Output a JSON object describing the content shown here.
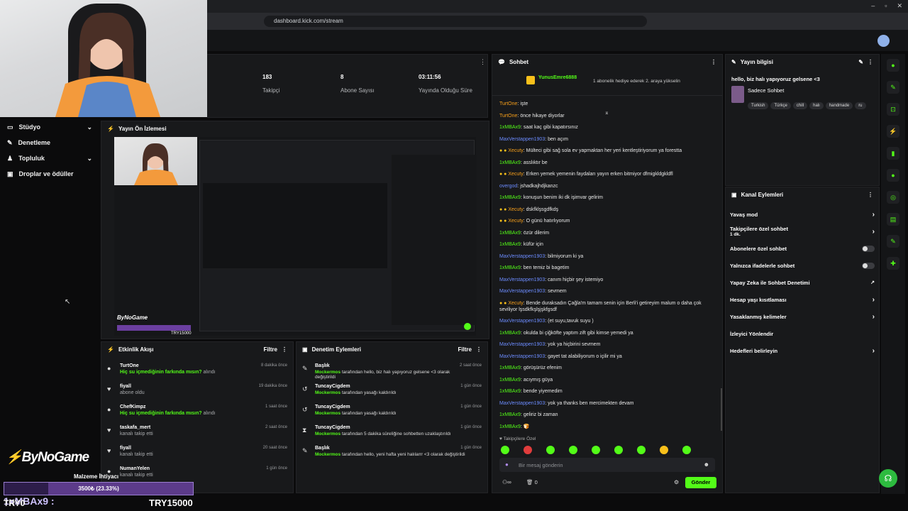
{
  "browser": {
    "url": "dashboard.kick.com/stream"
  },
  "sidebar": {
    "items": [
      {
        "label": "Stüdyo",
        "icon": "studio-icon"
      },
      {
        "label": "Denetleme",
        "icon": "wrench-icon"
      },
      {
        "label": "Topluluk",
        "icon": "community-icon"
      },
      {
        "label": "Droplar ve ödüller",
        "icon": "gift-icon"
      }
    ]
  },
  "stats": [
    {
      "value": "183",
      "label": "Takipçi"
    },
    {
      "value": "8",
      "label": "Abone Sayısı"
    },
    {
      "value": "03:11:56",
      "label": "Yayında Olduğu Süre"
    }
  ],
  "preview": {
    "title": "Yayın Ön İzlemesi",
    "brand": "ByNoGame",
    "goal": "TRY15000"
  },
  "activity": {
    "title": "Etkinlik Akışı",
    "filter": "Filtre",
    "items": [
      {
        "user": "TurtOne",
        "action": "Hiç su içmediğinin farkında mısın?",
        "suffix": "alındı",
        "time": "8 dakika önce"
      },
      {
        "user": "fiyall",
        "action": "abone oldu",
        "suffix": "",
        "time": "19 dakika önce"
      },
      {
        "user": "ChefKimpz",
        "action": "Hiç su içmediğinin farkında mısın?",
        "suffix": "alındı",
        "time": "1 saat önce"
      },
      {
        "user": "taskafa_mert",
        "action": "kanalı takip etti",
        "suffix": "",
        "time": "2 saat önce"
      },
      {
        "user": "fiyall",
        "action": "kanalı takip etti",
        "suffix": "",
        "time": "20 saat önce"
      },
      {
        "user": "NumanYelen",
        "action": "kanalı takip etti",
        "suffix": "",
        "time": "1 gün önce"
      }
    ]
  },
  "moderation": {
    "title": "Denetim Eylemleri",
    "filter": "Filtre",
    "items": [
      {
        "user": "Başlık",
        "mod": "Mockermos",
        "text": "tarafından hello, biz halı yapıyoruz gelsene <3 olarak değiştirildi",
        "time": "2 saat önce"
      },
      {
        "user": "TuncayCigdem",
        "mod": "Mockermos",
        "text": "tarafından yasağı kaldırıldı",
        "time": "1 gün önce"
      },
      {
        "user": "TuncayCigdem",
        "mod": "Mockermos",
        "text": "tarafından yasağı kaldırıldı",
        "time": "1 gün önce"
      },
      {
        "user": "TuncayCigdem",
        "mod": "Mockermos",
        "text": "tarafından 5 dakika süreliğine sohbetten uzaklaştırıldı",
        "time": "1 gün önce"
      },
      {
        "user": "Başlık",
        "mod": "Mockermos",
        "text": "tarafından hello, yeni hafta yeni halılarrr <3 olarak değiştirildi",
        "time": "1 gün önce"
      }
    ]
  },
  "chat": {
    "title": "Sohbet",
    "pinned_user": "YunusEmre6888",
    "pinned_text": "1 abonelik hediye ederek 2. araya yükselin",
    "messages": [
      {
        "user": "TurtOne",
        "color": "orange",
        "text": "işte"
      },
      {
        "user": "TurtOne",
        "color": "orange",
        "text": "önce hikaye diyorlar"
      },
      {
        "user": "1xMBAx9",
        "color": "green",
        "text": "saat kaç gibi kapatırsınız"
      },
      {
        "user": "MaxVerstappen1903",
        "color": "blue",
        "text": "ben açım"
      },
      {
        "user": "Xecuty",
        "color": "orange",
        "text": "Mülteci gibi sağ sola ev yapmaktan her yeri kentleştiriyorum ya forestta"
      },
      {
        "user": "1xMBAx9",
        "color": "green",
        "text": "asslıktır be"
      },
      {
        "user": "Xecuty",
        "color": "orange",
        "text": "Erken yemek yemenin faydaları yayın erken bitmiyor dfmigkldgkldfl"
      },
      {
        "user": "overgod",
        "color": "blue",
        "text": "jshadkajhdjkanzc"
      },
      {
        "user": "1xMBAx9",
        "color": "green",
        "text": "konuşun benim iki dk işimvar gelirim"
      },
      {
        "user": "Xecuty",
        "color": "orange",
        "text": "dskfklşsgdfkdş"
      },
      {
        "user": "Xecuty",
        "color": "orange",
        "text": "O günü hatırlıyorum"
      },
      {
        "user": "1xMBAx9",
        "color": "green",
        "text": "özür dilerim"
      },
      {
        "user": "1xMBAx9",
        "color": "green",
        "text": "küfür için"
      },
      {
        "user": "MaxVerstappen1903",
        "color": "blue",
        "text": "bilmiyorum ki ya"
      },
      {
        "user": "1xMBAx9",
        "color": "green",
        "text": "ben temiz bi bagetim"
      },
      {
        "user": "MaxVerstappen1903",
        "color": "blue",
        "text": "canım hiçbir şey istemiyo"
      },
      {
        "user": "MaxVerstappen1903",
        "color": "blue",
        "text": "sevmem"
      },
      {
        "user": "Xecuty",
        "color": "orange",
        "text": "Bende duraksadın Çağla'm tamam senin için Berli'i getireyim malum o daha çok seviliyor lşsdkfkşlşjşkfgsdf"
      },
      {
        "user": "MaxVerstappen1903",
        "color": "blue",
        "text": "(et suyu,tavuk suyu )"
      },
      {
        "user": "1xMBAx9",
        "color": "green",
        "text": "okulda bi çiğköfte yaptım zift gibi kimse yemedi ya"
      },
      {
        "user": "MaxVerstappen1903",
        "color": "blue",
        "text": "yok ya hiçbirini sevmem"
      },
      {
        "user": "MaxVerstappen1903",
        "color": "blue",
        "text": "gayet tat alabiliyorum o içilir mi ya"
      },
      {
        "user": "1xMBAx9",
        "color": "green",
        "text": "görüşürüz efenim"
      },
      {
        "user": "1xMBAx9",
        "color": "green",
        "text": "acıymış güya"
      },
      {
        "user": "1xMBAx9",
        "color": "green",
        "text": "bende yiyemedim"
      },
      {
        "user": "MaxVerstappen1903",
        "color": "blue",
        "text": "yok ya thanks ben mercimekten devam"
      },
      {
        "user": "1xMBAx9",
        "color": "green",
        "text": "geliriz bi zaman"
      },
      {
        "user": "1xMBAx9",
        "color": "green",
        "text": "🍞"
      }
    ],
    "mode": "Takipçilere Özel",
    "placeholder": "Bir mesaj gönderin",
    "count": "0",
    "send": "Gönder"
  },
  "stream_info": {
    "title": "Yayın bilgisi",
    "stream_title": "hello, biz halı yapıyoruz gelsene <3",
    "category": "Sadece Sohbet",
    "tags": [
      "Turkish",
      "Türkçe",
      "chill",
      "halı",
      "handmade",
      "ru"
    ]
  },
  "channel_actions": {
    "title": "Kanal Eylemleri",
    "items": [
      {
        "label": "Yavaş mod",
        "sub": "",
        "control": "chevron"
      },
      {
        "label": "Takipçilere özel sohbet",
        "sub": "1 dk.",
        "control": "chevron"
      },
      {
        "label": "Abonelere özel sohbet",
        "sub": "",
        "control": "toggle"
      },
      {
        "label": "Yalnızca ifadelerle sohbet",
        "sub": "",
        "control": "toggle"
      },
      {
        "label": "Yapay Zeka ile Sohbet Denetimi",
        "sub": "",
        "control": "external"
      },
      {
        "label": "Hesap yaşı kısıtlaması",
        "sub": "",
        "control": "chevron"
      },
      {
        "label": "Yasaklanmış kelimeler",
        "sub": "",
        "control": "chevron"
      },
      {
        "label": "İzleyici Yönlendir",
        "sub": "",
        "control": "none"
      },
      {
        "label": "Hedefleri belirleyin",
        "sub": "",
        "control": "chevron"
      }
    ]
  },
  "overlay": {
    "brand": "ByNoGame",
    "goal_label": "Malzeme İhtiyacı",
    "goal_progress": "3500₺ (23.33%)",
    "goal_fraction": 0.2333,
    "goal_target": "TRY15000",
    "last_user": "1xMBAx9 :",
    "last_left": "TRY0"
  },
  "colors": {
    "accent": "#53fc18",
    "orange": "#f8a01b",
    "blue": "#6c8cff"
  }
}
